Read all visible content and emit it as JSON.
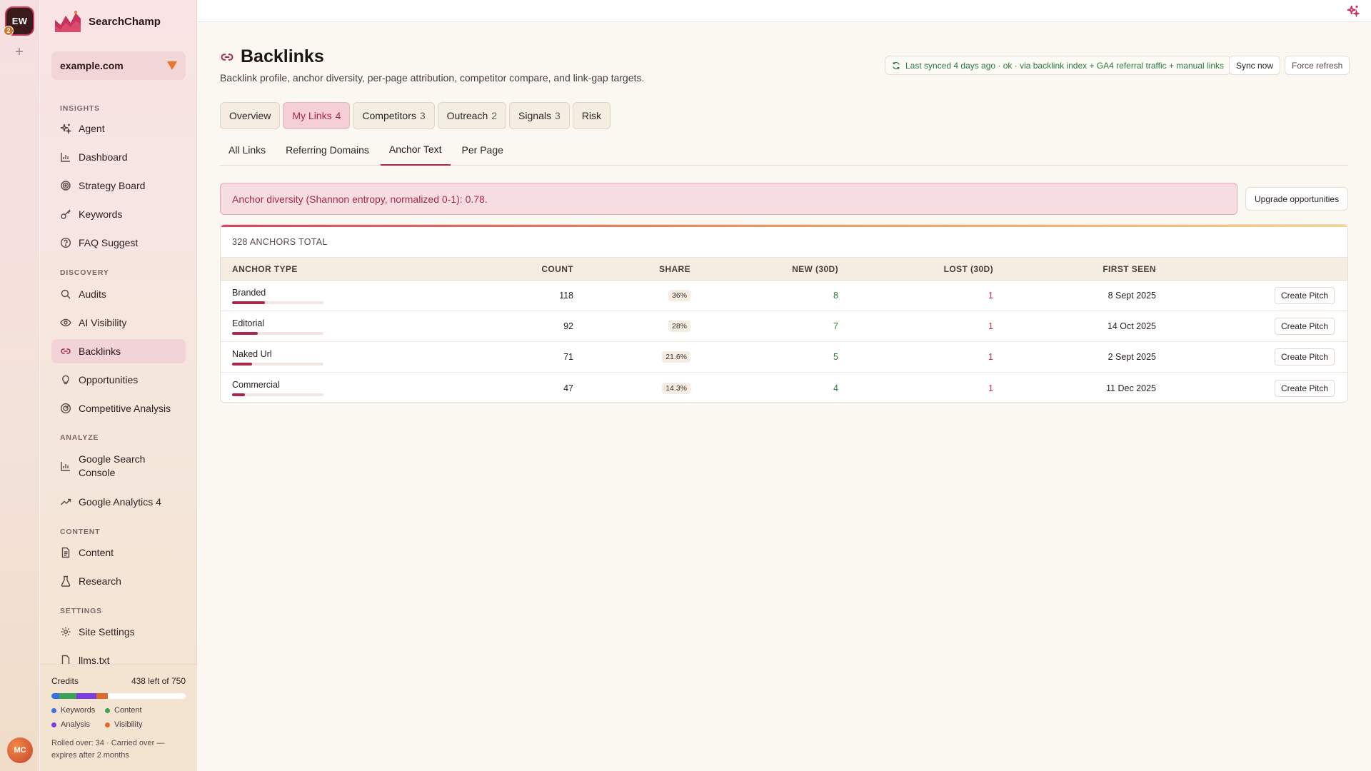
{
  "rail": {
    "workspace_initials": "EW",
    "workspace_badge": "2",
    "add_label": "+",
    "user_initials": "MC"
  },
  "brand": {
    "name": "SearchChamp"
  },
  "site_selector": {
    "value": "example.com"
  },
  "sidebar": {
    "sections": {
      "insights": "INSIGHTS",
      "discovery": "DISCOVERY",
      "analyze": "ANALYZE",
      "content": "CONTENT",
      "settings": "SETTINGS"
    },
    "items": [
      {
        "label": "Agent",
        "icon": "sparkle-icon"
      },
      {
        "label": "Dashboard",
        "icon": "bar-chart-icon"
      },
      {
        "label": "Strategy Board",
        "icon": "target-icon"
      },
      {
        "label": "Keywords",
        "icon": "key-icon"
      },
      {
        "label": "FAQ Suggest",
        "icon": "question-icon"
      },
      {
        "label": "Audits",
        "icon": "search-icon"
      },
      {
        "label": "AI Visibility",
        "icon": "eye-icon"
      },
      {
        "label": "Backlinks",
        "icon": "link-icon"
      },
      {
        "label": "Opportunities",
        "icon": "lightbulb-icon"
      },
      {
        "label": "Competitive Analysis",
        "icon": "radar-icon"
      },
      {
        "label": "Google Search Console",
        "icon": "bar-chart-icon"
      },
      {
        "label": "Google Analytics 4",
        "icon": "trend-icon"
      },
      {
        "label": "Content",
        "icon": "document-icon"
      },
      {
        "label": "Research",
        "icon": "flask-icon"
      },
      {
        "label": "Site Settings",
        "icon": "gear-icon"
      },
      {
        "label": "llms.txt",
        "icon": "file-icon"
      }
    ],
    "active": "Backlinks"
  },
  "credits": {
    "label": "Credits",
    "remaining": "438 left of 750",
    "legend": [
      "Keywords",
      "Content",
      "Analysis",
      "Visibility"
    ],
    "colors": [
      "#3b6fe0",
      "#3aa357",
      "#7a3ee0",
      "#e06a2a"
    ],
    "note": "Rolled over: 34 · Carried over — expires after 2 months"
  },
  "page": {
    "title": "Backlinks",
    "subtitle": "Backlink profile, anchor diversity, per-page attribution, competitor compare, and link-gap targets.",
    "sync_status": "Last synced 4 days ago · ok · via backlink index + GA4 referral traffic + manual links",
    "sync_now": "Sync now",
    "force_refresh": "Force refresh"
  },
  "tabs": [
    {
      "label": "Overview",
      "count": ""
    },
    {
      "label": "My Links",
      "count": "4"
    },
    {
      "label": "Competitors",
      "count": "3"
    },
    {
      "label": "Outreach",
      "count": "2"
    },
    {
      "label": "Signals",
      "count": "3"
    },
    {
      "label": "Risk",
      "count": ""
    }
  ],
  "subtabs": [
    "All Links",
    "Referring Domains",
    "Anchor Text",
    "Per Page"
  ],
  "alert": {
    "text": "Anchor diversity (Shannon entropy, normalized 0-1): 0.78."
  },
  "upgrade_button": "Upgrade opportunities",
  "table": {
    "summary": "328 ANCHORS TOTAL",
    "columns": [
      "ANCHOR TYPE",
      "COUNT",
      "SHARE",
      "NEW (30D)",
      "LOST (30D)",
      "FIRST SEEN"
    ],
    "action_label": "Create Pitch",
    "rows": [
      {
        "type": "Branded",
        "count": "118",
        "share": "36%",
        "share_frac": 0.36,
        "new": "8",
        "lost": "1",
        "first_seen": "8 Sept 2025"
      },
      {
        "type": "Editorial",
        "count": "92",
        "share": "28%",
        "share_frac": 0.28,
        "new": "7",
        "lost": "1",
        "first_seen": "14 Oct 2025"
      },
      {
        "type": "Naked Url",
        "count": "71",
        "share": "21.6%",
        "share_frac": 0.216,
        "new": "5",
        "lost": "1",
        "first_seen": "2 Sept 2025"
      },
      {
        "type": "Commercial",
        "count": "47",
        "share": "14.3%",
        "share_frac": 0.143,
        "new": "4",
        "lost": "1",
        "first_seen": "11 Dec 2025"
      }
    ]
  }
}
